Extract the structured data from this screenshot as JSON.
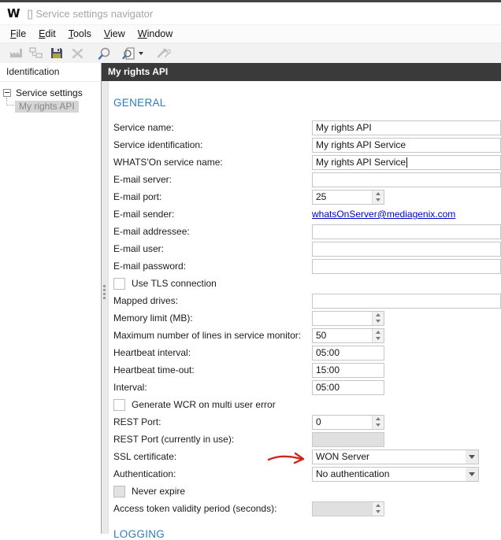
{
  "window": {
    "logo": "W",
    "title": "[] Service settings navigator"
  },
  "menu": {
    "items": [
      {
        "key": "F",
        "rest": "ile"
      },
      {
        "key": "E",
        "rest": "dit"
      },
      {
        "key": "T",
        "rest": "ools"
      },
      {
        "key": "V",
        "rest": "iew"
      },
      {
        "key": "W",
        "rest": "indow"
      }
    ]
  },
  "toolbar": {
    "buttons": [
      {
        "icon": "factory-icon",
        "enabled": false
      },
      {
        "icon": "hierarchy-icon",
        "enabled": false
      },
      {
        "icon": "save-icon",
        "enabled": true
      },
      {
        "icon": "delete-icon",
        "enabled": false
      },
      {
        "icon": "search-icon",
        "enabled": true
      },
      {
        "icon": "search-document-icon",
        "enabled": true,
        "has_dropdown": true
      },
      {
        "icon": "tools-icon",
        "enabled": false
      }
    ]
  },
  "sidebar": {
    "header": "Identification",
    "tree": {
      "root": "Service settings",
      "child": "My rights API",
      "child_selected": true
    }
  },
  "panel": {
    "header": "My rights API",
    "sections": {
      "general": "GENERAL",
      "logging": "LOGGING"
    }
  },
  "form": {
    "rows": [
      {
        "id": "service-name",
        "type": "text",
        "label": "Service name:",
        "value": "My rights API"
      },
      {
        "id": "service-identification",
        "type": "text",
        "label": "Service identification:",
        "value": "My rights API Service"
      },
      {
        "id": "whatson-service-name",
        "type": "text",
        "label": "WHATS'On service name:",
        "value": "My rights API Service",
        "caret": true
      },
      {
        "id": "email-server",
        "type": "text",
        "label": "E-mail server:",
        "value": ""
      },
      {
        "id": "email-port",
        "type": "spin",
        "label": "E-mail port:",
        "value": "25"
      },
      {
        "id": "email-sender",
        "type": "link",
        "label": "E-mail sender:",
        "value": "whatsOnServer@mediagenix.com"
      },
      {
        "id": "email-addressee",
        "type": "text",
        "label": "E-mail addressee:",
        "value": ""
      },
      {
        "id": "email-user",
        "type": "text",
        "label": "E-mail user:",
        "value": ""
      },
      {
        "id": "email-password",
        "type": "text",
        "label": "E-mail password:",
        "value": ""
      },
      {
        "id": "use-tls",
        "type": "checkbox",
        "label": "Use TLS connection",
        "checked": false,
        "disabled": false
      },
      {
        "id": "mapped-drives",
        "type": "text",
        "label": "Mapped drives:",
        "value": ""
      },
      {
        "id": "memory-limit",
        "type": "spin",
        "label": "Memory limit (MB):",
        "value": ""
      },
      {
        "id": "max-lines-service-monitor",
        "type": "spin",
        "label": "Maximum number of lines in service monitor:",
        "value": "50"
      },
      {
        "id": "heartbeat-interval",
        "type": "time",
        "label": "Heartbeat interval:",
        "value": "05:00"
      },
      {
        "id": "heartbeat-timeout",
        "type": "time",
        "label": "Heartbeat time-out:",
        "value": "15:00"
      },
      {
        "id": "interval",
        "type": "time",
        "label": "Interval:",
        "value": "05:00"
      },
      {
        "id": "generate-wcr",
        "type": "checkbox",
        "label": "Generate WCR on multi user error",
        "checked": false,
        "disabled": false
      },
      {
        "id": "rest-port",
        "type": "spin",
        "label": "REST Port:",
        "value": "0"
      },
      {
        "id": "rest-port-current",
        "type": "distext",
        "label": "REST Port (currently in use):",
        "value": ""
      },
      {
        "id": "ssl-certificate",
        "type": "dropdown",
        "label": "SSL certificate:",
        "value": "WON Server",
        "annotated": true
      },
      {
        "id": "authentication",
        "type": "dropdown",
        "label": "Authentication:",
        "value": "No authentication"
      },
      {
        "id": "never-expire",
        "type": "checkbox",
        "label": "Never expire",
        "checked": false,
        "disabled": true
      },
      {
        "id": "access-token-validity",
        "type": "spin",
        "label": "Access token validity period (seconds):",
        "value": "",
        "disabled": true
      }
    ]
  },
  "colors": {
    "section_accent": "#2c7cc0",
    "detail_header_bg": "#3a3a3a",
    "link": "#0000cc",
    "annotation_red": "#d0261b",
    "selection_gray": "#d5d5d5",
    "disabled_fill": "#e0e0e0"
  }
}
